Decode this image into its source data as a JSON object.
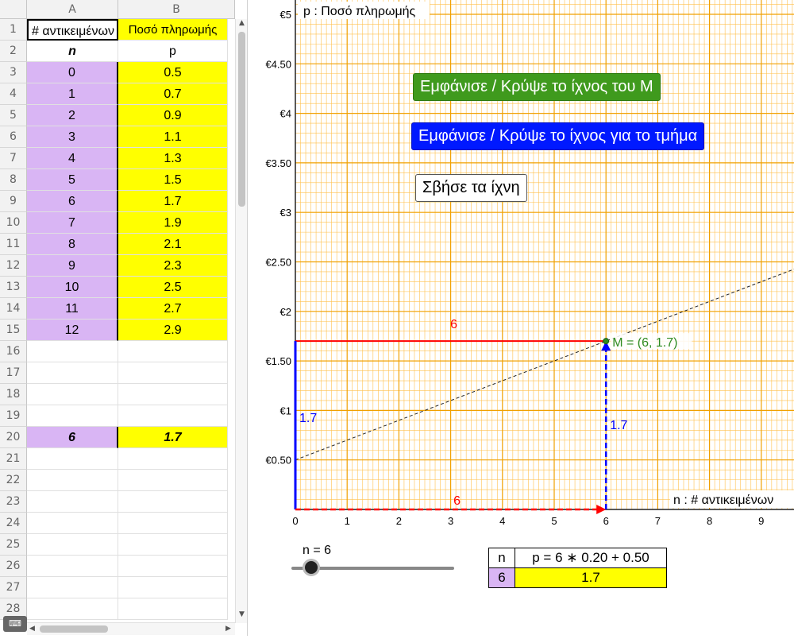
{
  "spreadsheet": {
    "columns": [
      "A",
      "B"
    ],
    "row_numbers": [
      "1",
      "2",
      "3",
      "4",
      "5",
      "6",
      "7",
      "8",
      "9",
      "10",
      "11",
      "12",
      "13",
      "14",
      "15",
      "16",
      "17",
      "18",
      "19",
      "20",
      "21",
      "22",
      "23",
      "24",
      "25",
      "26",
      "27",
      "28"
    ],
    "header_row": {
      "a": "# αντικειμένων",
      "b": "Ποσό πληρωμής"
    },
    "var_row": {
      "a": "n",
      "b": "p"
    },
    "data_rows": [
      {
        "a": "0",
        "b": "0.5"
      },
      {
        "a": "1",
        "b": "0.7"
      },
      {
        "a": "2",
        "b": "0.9"
      },
      {
        "a": "3",
        "b": "1.1"
      },
      {
        "a": "4",
        "b": "1.3"
      },
      {
        "a": "5",
        "b": "1.5"
      },
      {
        "a": "6",
        "b": "1.7"
      },
      {
        "a": "7",
        "b": "1.9"
      },
      {
        "a": "8",
        "b": "2.1"
      },
      {
        "a": "9",
        "b": "2.3"
      },
      {
        "a": "10",
        "b": "2.5"
      },
      {
        "a": "11",
        "b": "2.7"
      },
      {
        "a": "12",
        "b": "2.9"
      }
    ],
    "result_row": {
      "row": "20",
      "a": "6",
      "b": "1.7"
    },
    "keyboard_label": "⌨"
  },
  "graphics": {
    "buttons": {
      "toggle_trace_m": "Εμφάνισε / Κρύψε το ίχνος του Μ",
      "toggle_trace_segment": "Εμφάνισε / Κρύψε το ίχνος για το τμήμα",
      "clear_traces": "Σβήσε τα ίχνη"
    },
    "slider": {
      "label": "n = 6",
      "value": 6,
      "min": 0,
      "max": 50
    },
    "mini_table": {
      "n_header": "n",
      "formula": "p = 6 ∗ 0.20 + 0.50",
      "n_value": "6",
      "p_value": "1.7"
    },
    "colors": {
      "grid_minor": "#ffc04d",
      "grid_major": "#f0a000",
      "red": "#ff0000",
      "blue": "#0000ff",
      "green": "#2e8b20",
      "button_green": "#3f9a1d",
      "button_blue": "#0019ff"
    }
  },
  "chart_data": {
    "type": "line",
    "xlabel": "n : # αντικειμένων",
    "ylabel": "p : Ποσό πληρωμής",
    "xlim": [
      0,
      9.4
    ],
    "ylim": [
      0,
      5
    ],
    "x_ticks": [
      "0",
      "1",
      "2",
      "3",
      "4",
      "5",
      "6",
      "7",
      "8",
      "9"
    ],
    "y_ticks": [
      {
        "v": 0.5,
        "label": "€0.50"
      },
      {
        "v": 1,
        "label": "€1"
      },
      {
        "v": 1.5,
        "label": "€1.50"
      },
      {
        "v": 2,
        "label": "€2"
      },
      {
        "v": 2.5,
        "label": "€2.50"
      },
      {
        "v": 3,
        "label": "€3"
      },
      {
        "v": 3.5,
        "label": "€3.50"
      },
      {
        "v": 4,
        "label": "€4"
      },
      {
        "v": 4.5,
        "label": "€4.50"
      },
      {
        "v": 5,
        "label": "€5"
      }
    ],
    "line": {
      "slope": 0.2,
      "intercept": 0.5,
      "style": "dashed"
    },
    "point": {
      "x": 6,
      "y": 1.7,
      "label": "M = (6, 1.7)"
    },
    "segment_labels": {
      "horizontal_top": "6",
      "horizontal_bottom": "6",
      "vertical_left": "1.7",
      "vertical_right": "1.7"
    },
    "grid": true
  }
}
